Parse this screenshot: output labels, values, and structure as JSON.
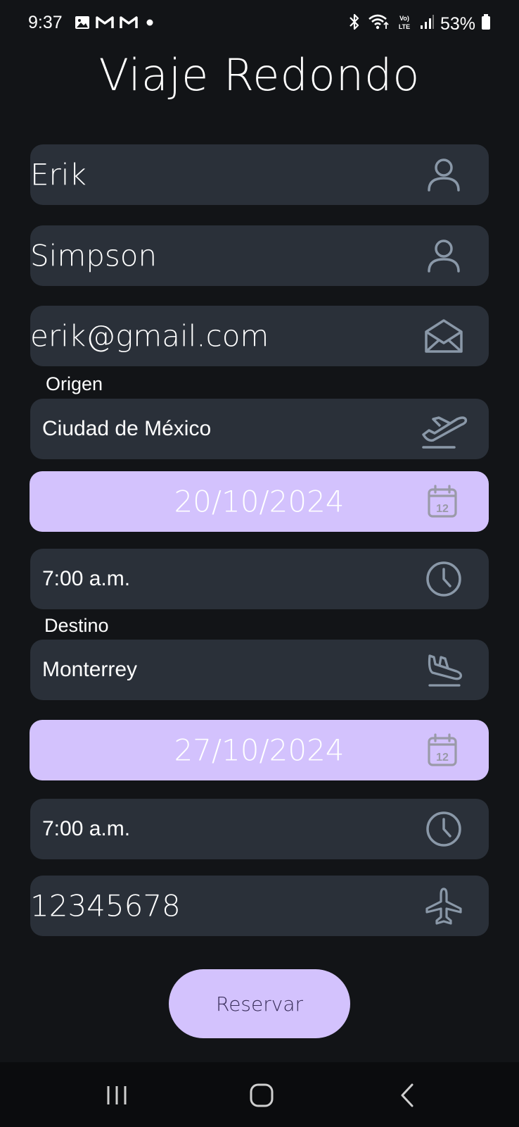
{
  "status_bar": {
    "time": "9:37",
    "battery": "53%",
    "icons": [
      "image-icon",
      "gmail-icon",
      "gmail-icon",
      "dot-icon",
      "bluetooth-icon",
      "wifi-icon",
      "volte-icon",
      "signal-icon",
      "battery-icon"
    ]
  },
  "page": {
    "title": "Viaje Redondo"
  },
  "form": {
    "first_name": "Erik",
    "last_name": "Simpson",
    "email": "erik@gmail.com",
    "origin_label": "Origen",
    "origin_city": "Ciudad de México",
    "departure_date": "20/10/2024",
    "departure_time": "7:00 a.m.",
    "destination_label": "Destino",
    "destination_city": "Monterrey",
    "return_date": "27/10/2024",
    "return_time": "7:00 a.m.",
    "booking_number": "12345678",
    "submit_label": "Reservar"
  },
  "calendar_icon_text": "12",
  "colors": {
    "background": "#121417",
    "field": "#2a3039",
    "accent": "#d3c2fd",
    "icon": "#8a98a8",
    "nav_bar": "#0b0c0e"
  }
}
